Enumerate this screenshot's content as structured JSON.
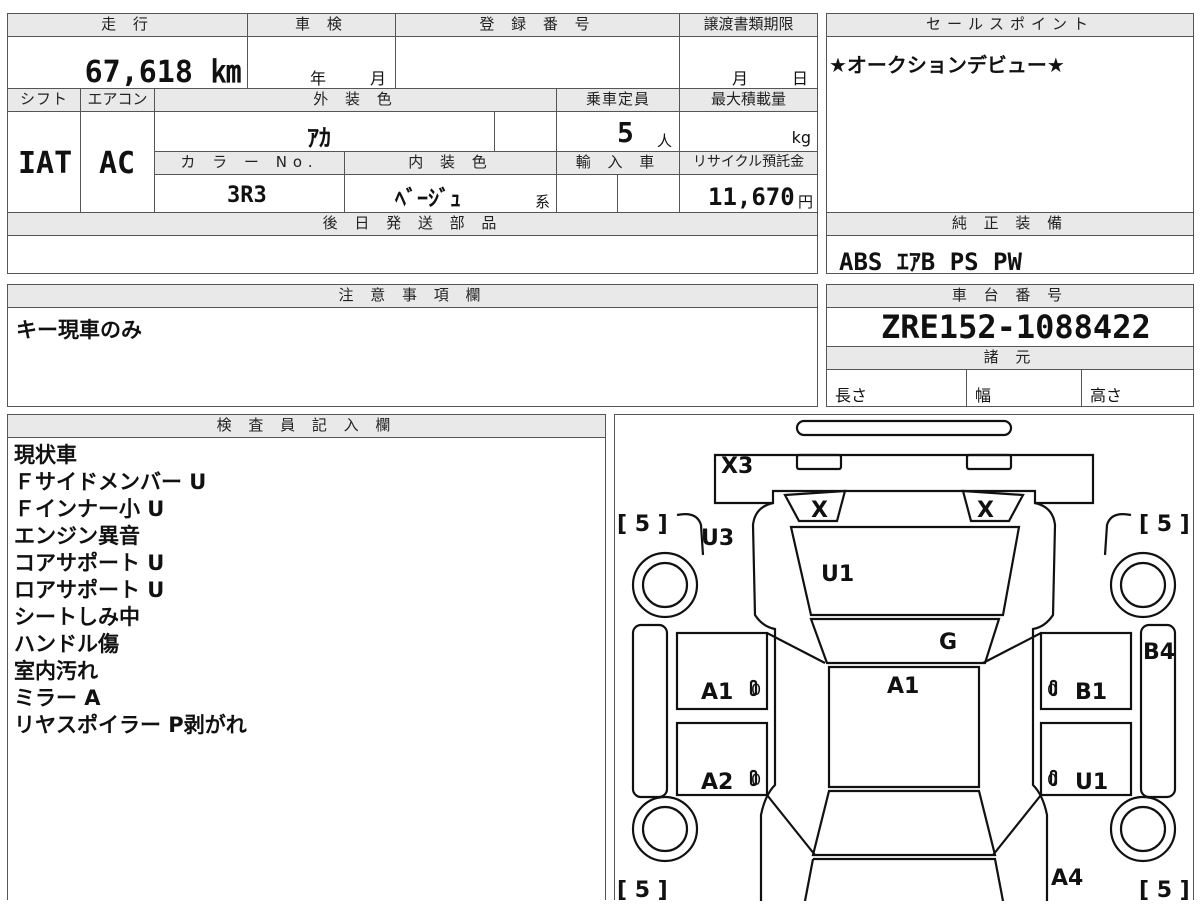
{
  "headers": {
    "mileage": "走 行",
    "inspection": "車 検",
    "registration": "登 録 番 号",
    "transfer_deadline": "譲渡書類期限",
    "sales_point": "セールスポイント",
    "shift": "シフト",
    "aircon": "エアコン",
    "exterior_color": "外 装 色",
    "capacity": "乗車定員",
    "max_load": "最大積載量",
    "color_no": "カ ラ ー No.",
    "interior_color": "内 装 色",
    "imported": "輸 入 車",
    "recycle_fee": "リサイクル預託金",
    "later_parts": "後 日 発 送 部 品",
    "standard_equipment": "純 正 装 備",
    "notes": "注 意 事 項 欄",
    "chassis_no": "車 台 番 号",
    "specs": "諸 元",
    "inspector": "検 査 員 記 入 欄"
  },
  "values": {
    "mileage": "67,618 ㎞",
    "inspection_year": "年",
    "inspection_month": "月",
    "deadline_month": "月",
    "deadline_day": "日",
    "sales_point": "★オークションデビュー★",
    "shift": "IAT",
    "aircon": "AC",
    "exterior_color": "ｱｶ",
    "capacity": "5",
    "capacity_unit": "人",
    "max_load_unit": "kg",
    "color_no": "3R3",
    "interior_color": "ﾍﾞｰｼﾞｭ",
    "interior_suffix": "系",
    "recycle_fee": "11,670",
    "recycle_unit": "円",
    "standard_equipment": "ABS ｴｱB PS PW",
    "notes": "キー現車のみ",
    "chassis_no": "ZRE152-1088422",
    "length_label": "長さ",
    "width_label": "幅",
    "height_label": "高さ"
  },
  "inspector_notes": [
    "現状車",
    "Ｆサイドメンバー U",
    "Ｆインナー小 U",
    "エンジン異音",
    "コアサポート U",
    "ロアサポート U",
    "シートしみ中",
    "ハンドル傷",
    "室内汚れ",
    "ミラー A",
    "リヤスポイラー P剥がれ"
  ],
  "diagram": {
    "marks": {
      "x3": "X3",
      "x_left": "X",
      "x_right": "X",
      "u3": "U3",
      "u1_hood": "U1",
      "g": "G",
      "a1_center": "A1",
      "a1_left": "A1",
      "b1": "B1",
      "b4": "B4",
      "a2": "A2",
      "u1_right": "U1",
      "a4": "A4",
      "zero_1": "0",
      "zero_2": "0",
      "zero_3": "0",
      "zero_4": "0"
    },
    "tires": {
      "fl": "[ 5 ]",
      "fr": "[ 5 ]",
      "rl": "[ 5 ]",
      "rr": "[ 5 ]"
    }
  }
}
